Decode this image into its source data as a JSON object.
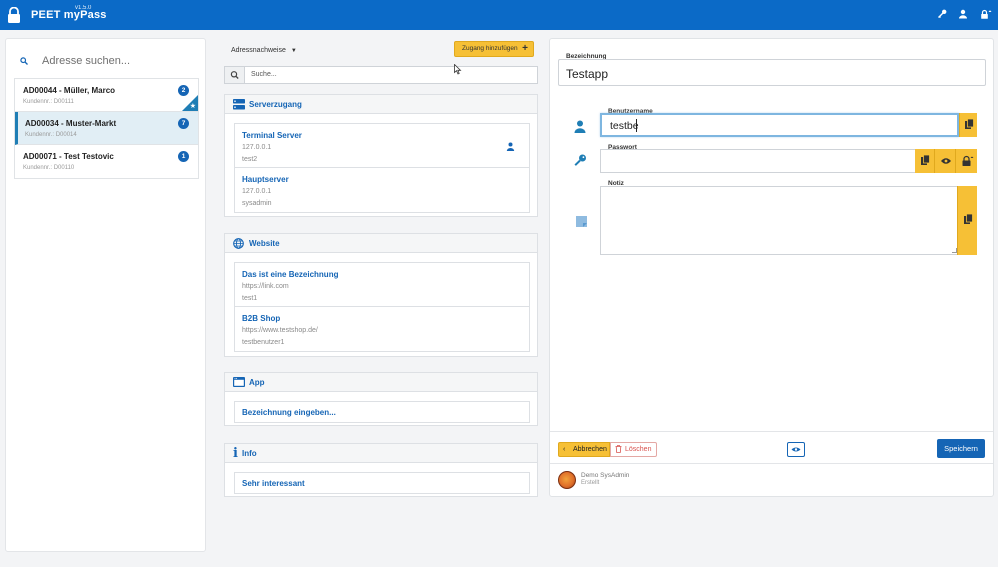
{
  "app": {
    "title": "PEET myPass",
    "version": "v1.5.0"
  },
  "topbar_icons": [
    "lock-icon",
    "key-icon",
    "user-icon",
    "logout-lock-icon"
  ],
  "address_panel": {
    "search_placeholder": "Adresse suchen...",
    "items": [
      {
        "name": "AD00044 - Müller, Marco",
        "sub": "Kundennr.: D00111",
        "count": "2",
        "starred": true
      },
      {
        "name": "AD00034 - Muster-Markt",
        "sub": "Kundennr.: D00014",
        "count": "7",
        "active": true
      },
      {
        "name": "AD00071 - Test Testovic",
        "sub": "Kundennr.: D00110",
        "count": "1"
      }
    ]
  },
  "middle": {
    "dropdown_label": "Adressnachweise",
    "add_button_label": "Zugang hinzufügen",
    "search_placeholder": "Suche...",
    "sections": {
      "server": {
        "title": "Serverzugang",
        "entries": [
          {
            "title": "Terminal Server",
            "line1": "127.0.0.1",
            "line2": "test2"
          },
          {
            "title": "Hauptserver",
            "line1": "127.0.0.1",
            "line2": "sysadmin"
          }
        ]
      },
      "website": {
        "title": "Website",
        "entries": [
          {
            "title": "Das ist eine Bezeichnung",
            "line1": "https://link.com",
            "line2": "test1"
          },
          {
            "title": "B2B Shop",
            "line1": "https://www.testshop.de/",
            "line2": "testbenutzer1"
          }
        ]
      },
      "app": {
        "title": "App",
        "entry": "Bezeichnung eingeben..."
      },
      "info": {
        "title": "Info",
        "entry": "Sehr interessant"
      }
    }
  },
  "detail": {
    "bezeichnung_label": "Bezeichnung",
    "bezeichnung_value": "Testapp",
    "benutzername_label": "Benutzername",
    "benutzername_value": "testbe",
    "passwort_label": "Passwort",
    "passwort_value": "",
    "notiz_label": "Notiz",
    "notiz_value": "",
    "cancel_label": "Abbrechen",
    "delete_label": "Löschen",
    "save_label": "Speichern",
    "creator_name": "Demo SysAdmin",
    "creator_role": "Erstellt"
  },
  "colors": {
    "topbar": "#0b6ac7",
    "accent_blue": "#1565b5",
    "accent_yellow": "#f6c036",
    "delete_red": "#d9534f"
  }
}
